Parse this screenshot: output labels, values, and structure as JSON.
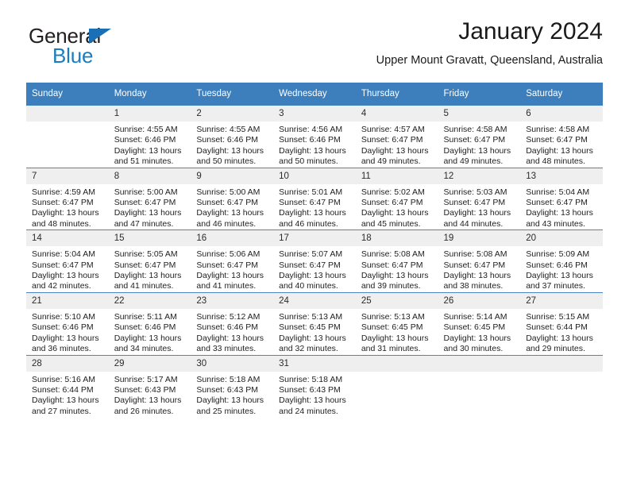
{
  "brand": {
    "name_top": "General",
    "name_bottom": "Blue",
    "accent_color": "#1a7cc1",
    "triangle_color": "#1a6fb5"
  },
  "header": {
    "title": "January 2024",
    "subtitle": "Upper Mount Gravatt, Queensland, Australia",
    "header_bg_color": "#3d7ebc",
    "daynum_bg_color": "#efefef"
  },
  "weekday_headers": [
    "Sunday",
    "Monday",
    "Tuesday",
    "Wednesday",
    "Thursday",
    "Friday",
    "Saturday"
  ],
  "weeks": [
    [
      {
        "day": "",
        "lines": []
      },
      {
        "day": "1",
        "lines": [
          "Sunrise: 4:55 AM",
          "Sunset: 6:46 PM",
          "Daylight: 13 hours",
          "and 51 minutes."
        ]
      },
      {
        "day": "2",
        "lines": [
          "Sunrise: 4:55 AM",
          "Sunset: 6:46 PM",
          "Daylight: 13 hours",
          "and 50 minutes."
        ]
      },
      {
        "day": "3",
        "lines": [
          "Sunrise: 4:56 AM",
          "Sunset: 6:46 PM",
          "Daylight: 13 hours",
          "and 50 minutes."
        ]
      },
      {
        "day": "4",
        "lines": [
          "Sunrise: 4:57 AM",
          "Sunset: 6:47 PM",
          "Daylight: 13 hours",
          "and 49 minutes."
        ]
      },
      {
        "day": "5",
        "lines": [
          "Sunrise: 4:58 AM",
          "Sunset: 6:47 PM",
          "Daylight: 13 hours",
          "and 49 minutes."
        ]
      },
      {
        "day": "6",
        "lines": [
          "Sunrise: 4:58 AM",
          "Sunset: 6:47 PM",
          "Daylight: 13 hours",
          "and 48 minutes."
        ]
      }
    ],
    [
      {
        "day": "7",
        "lines": [
          "Sunrise: 4:59 AM",
          "Sunset: 6:47 PM",
          "Daylight: 13 hours",
          "and 48 minutes."
        ]
      },
      {
        "day": "8",
        "lines": [
          "Sunrise: 5:00 AM",
          "Sunset: 6:47 PM",
          "Daylight: 13 hours",
          "and 47 minutes."
        ]
      },
      {
        "day": "9",
        "lines": [
          "Sunrise: 5:00 AM",
          "Sunset: 6:47 PM",
          "Daylight: 13 hours",
          "and 46 minutes."
        ]
      },
      {
        "day": "10",
        "lines": [
          "Sunrise: 5:01 AM",
          "Sunset: 6:47 PM",
          "Daylight: 13 hours",
          "and 46 minutes."
        ]
      },
      {
        "day": "11",
        "lines": [
          "Sunrise: 5:02 AM",
          "Sunset: 6:47 PM",
          "Daylight: 13 hours",
          "and 45 minutes."
        ]
      },
      {
        "day": "12",
        "lines": [
          "Sunrise: 5:03 AM",
          "Sunset: 6:47 PM",
          "Daylight: 13 hours",
          "and 44 minutes."
        ]
      },
      {
        "day": "13",
        "lines": [
          "Sunrise: 5:04 AM",
          "Sunset: 6:47 PM",
          "Daylight: 13 hours",
          "and 43 minutes."
        ]
      }
    ],
    [
      {
        "day": "14",
        "lines": [
          "Sunrise: 5:04 AM",
          "Sunset: 6:47 PM",
          "Daylight: 13 hours",
          "and 42 minutes."
        ]
      },
      {
        "day": "15",
        "lines": [
          "Sunrise: 5:05 AM",
          "Sunset: 6:47 PM",
          "Daylight: 13 hours",
          "and 41 minutes."
        ]
      },
      {
        "day": "16",
        "lines": [
          "Sunrise: 5:06 AM",
          "Sunset: 6:47 PM",
          "Daylight: 13 hours",
          "and 41 minutes."
        ]
      },
      {
        "day": "17",
        "lines": [
          "Sunrise: 5:07 AM",
          "Sunset: 6:47 PM",
          "Daylight: 13 hours",
          "and 40 minutes."
        ]
      },
      {
        "day": "18",
        "lines": [
          "Sunrise: 5:08 AM",
          "Sunset: 6:47 PM",
          "Daylight: 13 hours",
          "and 39 minutes."
        ]
      },
      {
        "day": "19",
        "lines": [
          "Sunrise: 5:08 AM",
          "Sunset: 6:47 PM",
          "Daylight: 13 hours",
          "and 38 minutes."
        ]
      },
      {
        "day": "20",
        "lines": [
          "Sunrise: 5:09 AM",
          "Sunset: 6:46 PM",
          "Daylight: 13 hours",
          "and 37 minutes."
        ]
      }
    ],
    [
      {
        "day": "21",
        "lines": [
          "Sunrise: 5:10 AM",
          "Sunset: 6:46 PM",
          "Daylight: 13 hours",
          "and 36 minutes."
        ]
      },
      {
        "day": "22",
        "lines": [
          "Sunrise: 5:11 AM",
          "Sunset: 6:46 PM",
          "Daylight: 13 hours",
          "and 34 minutes."
        ]
      },
      {
        "day": "23",
        "lines": [
          "Sunrise: 5:12 AM",
          "Sunset: 6:46 PM",
          "Daylight: 13 hours",
          "and 33 minutes."
        ]
      },
      {
        "day": "24",
        "lines": [
          "Sunrise: 5:13 AM",
          "Sunset: 6:45 PM",
          "Daylight: 13 hours",
          "and 32 minutes."
        ]
      },
      {
        "day": "25",
        "lines": [
          "Sunrise: 5:13 AM",
          "Sunset: 6:45 PM",
          "Daylight: 13 hours",
          "and 31 minutes."
        ]
      },
      {
        "day": "26",
        "lines": [
          "Sunrise: 5:14 AM",
          "Sunset: 6:45 PM",
          "Daylight: 13 hours",
          "and 30 minutes."
        ]
      },
      {
        "day": "27",
        "lines": [
          "Sunrise: 5:15 AM",
          "Sunset: 6:44 PM",
          "Daylight: 13 hours",
          "and 29 minutes."
        ]
      }
    ],
    [
      {
        "day": "28",
        "lines": [
          "Sunrise: 5:16 AM",
          "Sunset: 6:44 PM",
          "Daylight: 13 hours",
          "and 27 minutes."
        ]
      },
      {
        "day": "29",
        "lines": [
          "Sunrise: 5:17 AM",
          "Sunset: 6:43 PM",
          "Daylight: 13 hours",
          "and 26 minutes."
        ]
      },
      {
        "day": "30",
        "lines": [
          "Sunrise: 5:18 AM",
          "Sunset: 6:43 PM",
          "Daylight: 13 hours",
          "and 25 minutes."
        ]
      },
      {
        "day": "31",
        "lines": [
          "Sunrise: 5:18 AM",
          "Sunset: 6:43 PM",
          "Daylight: 13 hours",
          "and 24 minutes."
        ]
      },
      {
        "day": "",
        "lines": []
      },
      {
        "day": "",
        "lines": []
      },
      {
        "day": "",
        "lines": []
      }
    ]
  ]
}
